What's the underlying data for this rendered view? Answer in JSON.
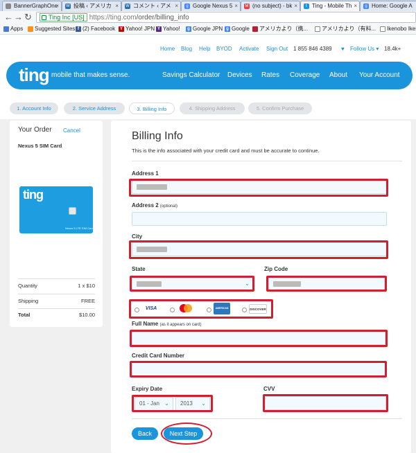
{
  "browser": {
    "tabs": [
      {
        "title": "BannerGraphOne",
        "active": false
      },
      {
        "title": "投稿 ‹ アメリカ",
        "active": false
      },
      {
        "title": "コメント ‹ アメ",
        "active": false
      },
      {
        "title": "Google Nexus 5",
        "active": false
      },
      {
        "title": "(no subject) - bk",
        "active": false
      },
      {
        "title": "Ting - Mobile Th",
        "active": true
      },
      {
        "title": "Home: Google A",
        "active": false
      }
    ],
    "ev_label": "Ting Inc [US]",
    "url_host": "https://ting.com",
    "url_path": "/order/billing_info",
    "bookmarks": [
      "Apps",
      "Suggested Sites",
      "(2) Facebook",
      "Yahoo! JPN",
      "Yahoo!",
      "Google JPN",
      "Google",
      "アメリカより（携...",
      "アメリカより（有料...",
      "Ikenobo Ikeba"
    ]
  },
  "util_nav": {
    "links": [
      "Home",
      "Blog",
      "Help",
      "BYOD",
      "Activate",
      "Sign Out"
    ],
    "phone": "1 855 846 4389",
    "follow": "Follow Us",
    "count": "18.4k+"
  },
  "header": {
    "logo": "ting",
    "tagline": "mobile that makes sense.",
    "nav": [
      "Savings Calculator",
      "Devices",
      "Rates",
      "Coverage",
      "About",
      "Your Account"
    ]
  },
  "steps": [
    "1. Account Info",
    "2. Service Address",
    "3. Billing Info",
    "4. Shipping Address",
    "5. Confirm Purchase"
  ],
  "order": {
    "title": "Your Order",
    "cancel": "Cancel",
    "product": "Nexus 5 SIM Card",
    "sim_logo": "ting",
    "sim_text": "Nexus 5 LTE SIM Card",
    "rows": [
      {
        "label": "Quantity",
        "value": "1 x $10"
      },
      {
        "label": "Shipping",
        "value": "FREE"
      },
      {
        "label": "Total",
        "value": "$10.00"
      }
    ]
  },
  "billing": {
    "title": "Billing Info",
    "description": "This is the info associated with your credit card and must be accurate to continue.",
    "address1_label": "Address 1",
    "address2_label": "Address 2",
    "address2_note": "(optional)",
    "city_label": "City",
    "state_label": "State",
    "zip_label": "Zip Code",
    "cards": [
      "VISA",
      "MasterCard",
      "AMERICAN EXPRESS",
      "DISCOVER"
    ],
    "fullname_label": "Full Name",
    "fullname_note": "(as it appears on card)",
    "ccnum_label": "Credit Card Number",
    "expiry_label": "Expiry Date",
    "cvv_label": "CVV",
    "expiry_month": "01 - Jan",
    "expiry_year": "2013",
    "back": "Back",
    "next": "Next Step"
  },
  "colors": {
    "brand": "#1a94da",
    "highlight": "#d02030",
    "field_bg": "#f2faff"
  }
}
